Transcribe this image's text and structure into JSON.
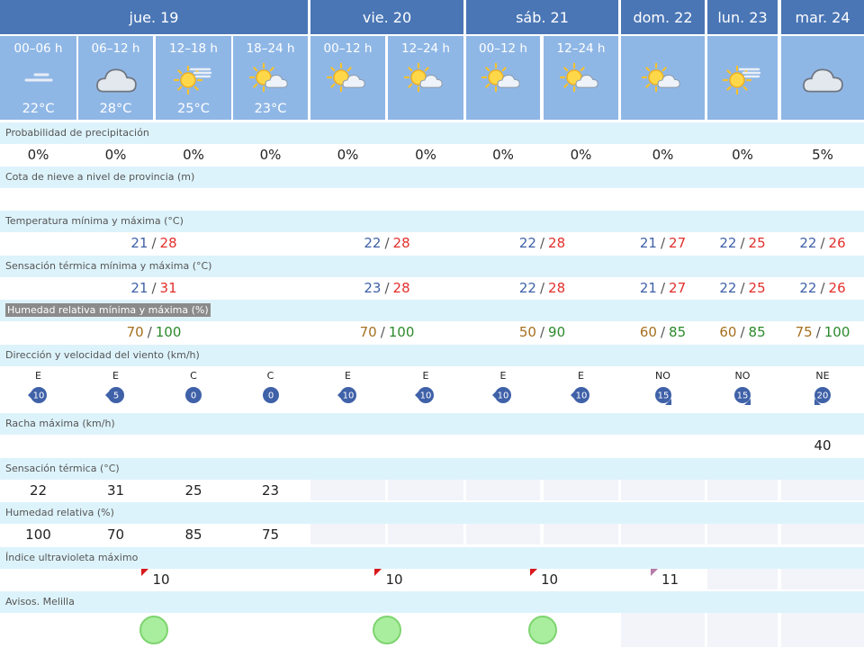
{
  "days": [
    {
      "label": "jue. 19",
      "periods": [
        {
          "time": "00–06 h",
          "temp": "22°C",
          "icon": "haze-icon"
        },
        {
          "time": "06–12 h",
          "temp": "28°C",
          "icon": "cloud-icon"
        },
        {
          "time": "12–18 h",
          "temp": "25°C",
          "icon": "sun-haze-icon"
        },
        {
          "time": "18–24 h",
          "temp": "23°C",
          "icon": "sun-cloud-icon"
        }
      ]
    },
    {
      "label": "vie. 20",
      "periods": [
        {
          "time": "00–12 h",
          "temp": "",
          "icon": "sun-cloud-icon"
        },
        {
          "time": "12–24 h",
          "temp": "",
          "icon": "sun-cloud-icon"
        }
      ]
    },
    {
      "label": "sáb. 21",
      "periods": [
        {
          "time": "00–12 h",
          "temp": "",
          "icon": "sun-cloud-icon"
        },
        {
          "time": "12–24 h",
          "temp": "",
          "icon": "sun-cloud-icon"
        }
      ]
    },
    {
      "label": "dom. 22",
      "periods": [
        {
          "time": "",
          "temp": "",
          "icon": "sun-cloud-icon"
        }
      ]
    },
    {
      "label": "lun. 23",
      "periods": [
        {
          "time": "",
          "temp": "",
          "icon": "sun-haze-icon"
        }
      ]
    },
    {
      "label": "mar. 24",
      "periods": [
        {
          "time": "",
          "temp": "",
          "icon": "cloud-icon"
        }
      ]
    }
  ],
  "labels": {
    "precip": "Probabilidad de precipitación",
    "snow": "Cota de nieve a nivel de provincia (m)",
    "temp": "Temperatura mínima y máxima (°C)",
    "feel": "Sensación térmica mínima y máxima (°C)",
    "hum": "Humedad relativa mínima y máxima (%)",
    "wind": "Dirección y velocidad del viento (km/h)",
    "gust": "Racha máxima (km/h)",
    "feel_p": "Sensación térmica (°C)",
    "hum_p": "Humedad relativa (%)",
    "uv": "Índice ultravioleta máximo",
    "warn": "Avisos. Melilla"
  },
  "precip": [
    "0%",
    "0%",
    "0%",
    "0%",
    "0%",
    "0%",
    "0%",
    "0%",
    "0%",
    "0%",
    "5%"
  ],
  "gust": [
    "",
    "",
    "",
    "",
    "",
    "",
    "",
    "",
    "",
    "",
    "40"
  ],
  "temp_minmax": [
    {
      "min": "21",
      "max": "28"
    },
    {
      "min": "22",
      "max": "28"
    },
    {
      "min": "22",
      "max": "28"
    },
    {
      "min": "21",
      "max": "27"
    },
    {
      "min": "22",
      "max": "25"
    },
    {
      "min": "22",
      "max": "26"
    }
  ],
  "feel_minmax": [
    {
      "min": "21",
      "max": "31"
    },
    {
      "min": "23",
      "max": "28"
    },
    {
      "min": "22",
      "max": "28"
    },
    {
      "min": "21",
      "max": "27"
    },
    {
      "min": "22",
      "max": "25"
    },
    {
      "min": "22",
      "max": "26"
    }
  ],
  "hum_minmax": [
    {
      "min": "70",
      "max": "100"
    },
    {
      "min": "70",
      "max": "100"
    },
    {
      "min": "50",
      "max": "90"
    },
    {
      "min": "60",
      "max": "85"
    },
    {
      "min": "60",
      "max": "85"
    },
    {
      "min": "75",
      "max": "100"
    }
  ],
  "wind": [
    {
      "dir": "E",
      "speed": "10"
    },
    {
      "dir": "E",
      "speed": "5"
    },
    {
      "dir": "C",
      "speed": "0"
    },
    {
      "dir": "C",
      "speed": "0"
    },
    {
      "dir": "E",
      "speed": "10"
    },
    {
      "dir": "E",
      "speed": "10"
    },
    {
      "dir": "E",
      "speed": "10"
    },
    {
      "dir": "E",
      "speed": "10"
    },
    {
      "dir": "NO",
      "speed": "15"
    },
    {
      "dir": "NO",
      "speed": "15"
    },
    {
      "dir": "NE",
      "speed": "20"
    }
  ],
  "feel_period": [
    "22",
    "31",
    "25",
    "23"
  ],
  "hum_period": [
    "100",
    "70",
    "85",
    "75"
  ],
  "uv": [
    {
      "value": "10",
      "color": "#d7191c"
    },
    {
      "value": "10",
      "color": "#d7191c"
    },
    {
      "value": "10",
      "color": "#d7191c"
    },
    {
      "value": "11",
      "color": "#b87aa6"
    }
  ],
  "warnings": [
    "green",
    "green",
    "green"
  ],
  "colors": {
    "header_day": "#4a76b5",
    "header_period": "#8fb7e6",
    "label_row": "#ddf3fb",
    "max_temp": "#e2302c",
    "min_temp": "#3f61a8",
    "humidity_max": "#2b8a2b",
    "humidity_min": "#a5701f",
    "wind_marker": "#3f61a8",
    "warning_green": "#a9ee9e"
  }
}
